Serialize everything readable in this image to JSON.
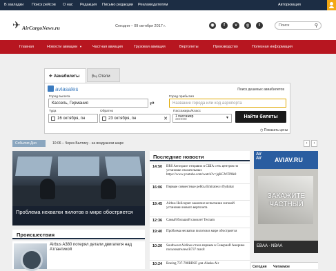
{
  "topbar": {
    "links": [
      "В закладки",
      "Поиск рейсов",
      "О нас",
      "Редакция",
      "Письмо редакции",
      "Рекламодателям"
    ],
    "auth": "Авторизация"
  },
  "header": {
    "logo_text": "AirCargoNews.ru",
    "date": "Сегодня – 09 октября 2017 г.",
    "social": [
      "rss",
      "f",
      "vk",
      "g+",
      "tw"
    ],
    "search_placeholder": "Поиск"
  },
  "nav": [
    "Главная",
    "Новости авиации",
    "Частная авиация",
    "Грузовая авиация",
    "Вертолеты",
    "Производство",
    "Полезная информация"
  ],
  "widget": {
    "tabs": [
      "Авиабилеты",
      "Отели"
    ],
    "brand": "aviasales",
    "hint": "Поиск дешевых авиабилетов",
    "from_label": "Город вылета",
    "from_value": "Кассель, Германия",
    "to_label": "Город прибытия",
    "to_placeholder": "Название города или код аэропорта",
    "depart_label": "Туда",
    "depart_value": "16 октября, пн",
    "return_label": "Обратно",
    "return_value": "23 октября, пн",
    "pax_label": "Пассажиры/Класс",
    "pax_value": "1 пассажир",
    "pax_class": "эконом",
    "search_button": "Найти билеты",
    "show_prices": "Показать цены"
  },
  "ticker": {
    "tag": "События Дня",
    "text": "10:06 – Через Балтику - на воздушном шаре"
  },
  "featured": {
    "caption": "Проблема нехватки пилотов в мире обостряется"
  },
  "incidents": {
    "title": "Происшествия",
    "item": "Airbus A380 потерял детали двигателя над Атлантикой"
  },
  "latest": {
    "title": "Последние новости",
    "items": [
      {
        "time": "14:50",
        "text": "BRS Aerospace отправил в США сеть центров по установке спасательных https://www.youtube.com/watch?v=jqKGWFP0k0"
      },
      {
        "time": "16:06",
        "text": "Первые совместные рейсы Emirates и flydubai"
      },
      {
        "time": "19:45",
        "text": "Airbus Helicopter закончил испытания сиговой установки нового вертолета"
      },
      {
        "time": "12:36",
        "text": "Самый большой самолет Tecnam"
      },
      {
        "time": "19:40",
        "text": "Проблема нехватки пилотов в мире обостряется"
      },
      {
        "time": "10:20",
        "text": "Southwest Airlines стала первым в Северной Америке пользователем B737 max8"
      },
      {
        "time": "10:24",
        "text": "Boeing 737-700BDSF для Alaska Air"
      }
    ]
  },
  "ad": {
    "badge_top": "AV",
    "badge_bottom": "AV",
    "url": "AVIAV.RU",
    "headline": "ЗАКАЖИТЕ ЧАСТНЫЙ",
    "footer": "EBAA · NBAA"
  },
  "bottom_tabs": [
    "Сегодня",
    "Читаемое"
  ]
}
